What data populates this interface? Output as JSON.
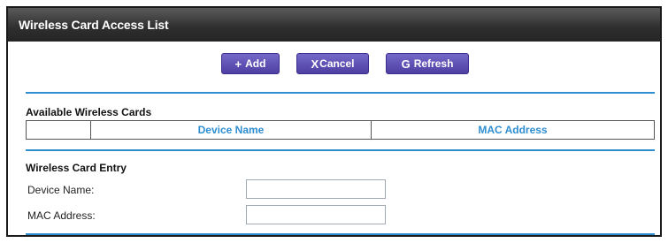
{
  "header": {
    "title": "Wireless Card Access List"
  },
  "toolbar": {
    "add": {
      "label": "Add",
      "icon": "+"
    },
    "cancel": {
      "label": "Cancel",
      "icon": "X"
    },
    "refresh": {
      "label": "Refresh",
      "icon": "G"
    }
  },
  "available": {
    "title": "Available Wireless Cards",
    "columns": [
      "",
      "Device Name",
      "MAC Address"
    ]
  },
  "entry": {
    "title": "Wireless Card Entry",
    "device_name_label": "Device Name:",
    "device_name_value": "",
    "mac_label": "MAC Address:",
    "mac_value": ""
  },
  "colors": {
    "accent_button": "#4e3fa3",
    "rule_blue": "#2d8fcf",
    "column_text": "#2e8ed0"
  }
}
